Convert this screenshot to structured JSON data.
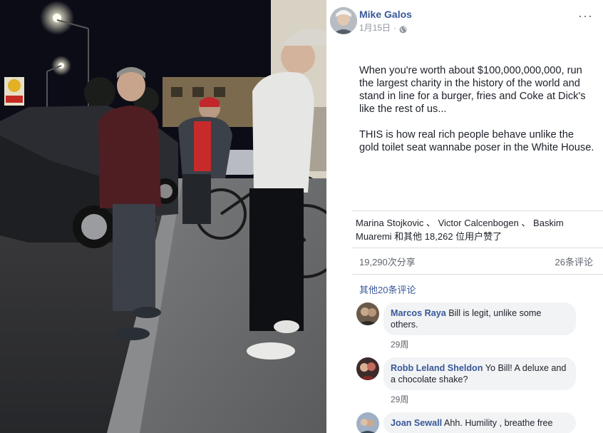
{
  "post": {
    "author": "Mike Galos",
    "date": "1月15日",
    "separator": "·",
    "more": "···",
    "body": [
      "When you're worth about $100,000,000,000, run the largest charity in the history of the world and stand in line for a burger, fries and Coke at Dick's like the rest of us...",
      "THIS is how real rich people behave unlike the gold toilet seat wannabe poser in the White House."
    ]
  },
  "likes": {
    "text": "Marina Stojkovic 、 Victor Calcenbogen 、 Baskim Muaremi 和其他 18,262 位用户赞了"
  },
  "stats": {
    "shares": "19,290次分享",
    "comments": "26条评论"
  },
  "comments_section": {
    "more_label": "其他20条评论",
    "items": [
      {
        "name": "Marcos Raya",
        "text": "Bill is legit, unlike some others.",
        "time": "29周"
      },
      {
        "name": "Robb Leland Sheldon",
        "text": "Yo Bill! A deluxe and a chocolate shake?",
        "time": "29周"
      },
      {
        "name": "Joan Sewall",
        "text": "Ahh. Humility , breathe free",
        "time": ""
      }
    ]
  },
  "colors": {
    "link": "#385898",
    "text": "#1d2129",
    "muted": "#606770",
    "bubble": "#f2f3f5"
  },
  "icons": [
    "globe-icon",
    "more-options-icon"
  ]
}
